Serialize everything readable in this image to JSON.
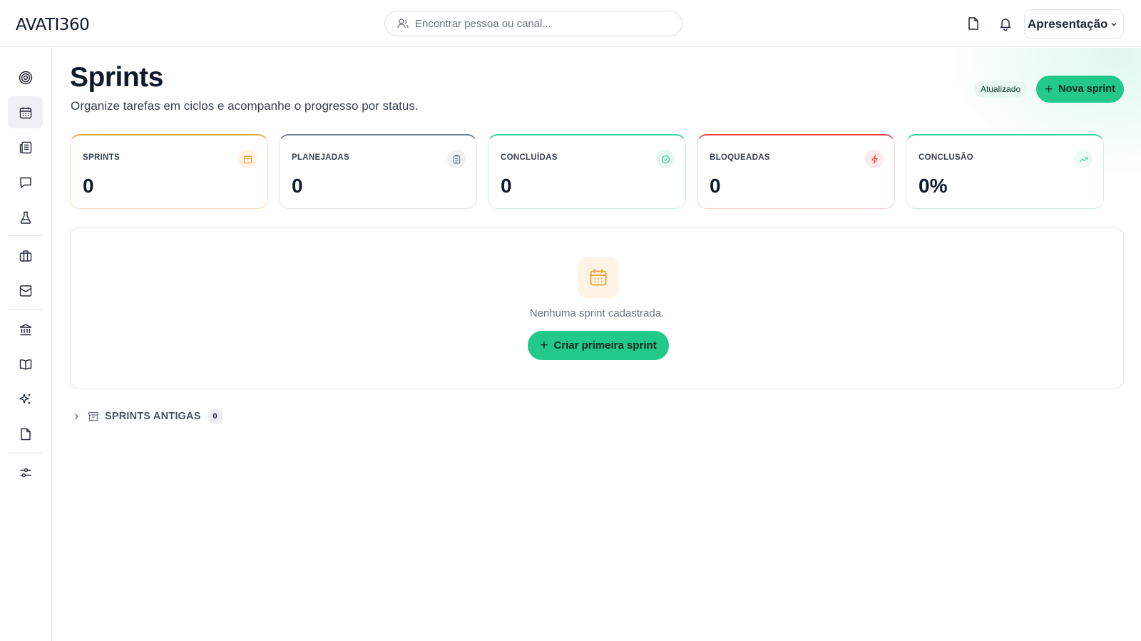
{
  "app": {
    "logo": "AVATI360"
  },
  "search": {
    "placeholder": "Encontrar pessoa ou canal..."
  },
  "header": {
    "profile_name": "Apresentação"
  },
  "sidebar": {
    "items": [
      {
        "icon": "target-icon"
      },
      {
        "icon": "calendar-icon",
        "active": true
      },
      {
        "icon": "newspaper-icon"
      },
      {
        "icon": "chat-icon"
      },
      {
        "icon": "flask-icon"
      },
      {
        "icon": "briefcase-icon"
      },
      {
        "icon": "inbox-icon"
      },
      {
        "icon": "bank-icon"
      },
      {
        "icon": "book-icon"
      },
      {
        "icon": "sparkles-icon"
      },
      {
        "icon": "document-icon"
      },
      {
        "icon": "sliders-icon"
      }
    ]
  },
  "page": {
    "title": "Sprints",
    "subtitle": "Organize tarefas em ciclos e acompanhe o progresso por status.",
    "updated_badge": "Atualizado",
    "new_button": "Nova sprint"
  },
  "stats": [
    {
      "label": "SPRINTS",
      "value": "0",
      "color": "#f0a53a",
      "icon": "calendar-icon"
    },
    {
      "label": "PLANEJADAS",
      "value": "0",
      "color": "#6b7f8c",
      "icon": "clipboard-icon"
    },
    {
      "label": "CONCLUÍDAS",
      "value": "0",
      "color": "#34d399",
      "icon": "check-circle-icon"
    },
    {
      "label": "BLOQUEADAS",
      "value": "0",
      "color": "#ef4444",
      "icon": "lightning-icon"
    },
    {
      "label": "CONCLUSÃO",
      "value": "0%",
      "color": "#34d399",
      "icon": "trending-up-icon"
    }
  ],
  "empty": {
    "message": "Nenhuma sprint cadastrada.",
    "button": "Criar primeira sprint"
  },
  "old_sprints": {
    "label": "SPRINTS ANTIGAS",
    "count": "0"
  },
  "colors": {
    "accent": "#22c98a"
  }
}
